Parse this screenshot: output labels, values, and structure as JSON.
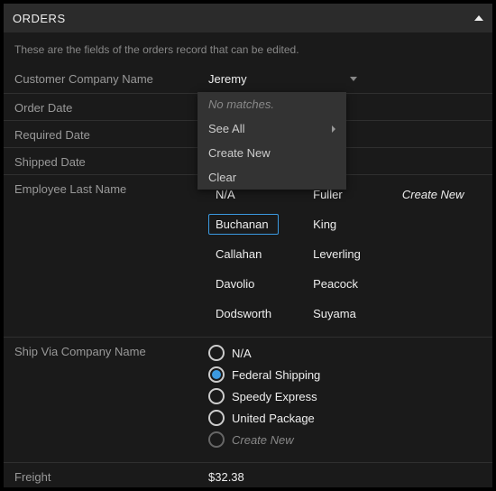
{
  "header": {
    "title": "ORDERS"
  },
  "helper": "These are the fields of the orders record that can be edited.",
  "fields": {
    "customerCompanyName": {
      "label": "Customer Company Name",
      "value": "Jeremy"
    },
    "orderDate": {
      "label": "Order Date"
    },
    "requiredDate": {
      "label": "Required Date"
    },
    "shippedDate": {
      "label": "Shipped Date"
    },
    "employeeLastName": {
      "label": "Employee Last Name"
    },
    "shipViaCompanyName": {
      "label": "Ship Via Company Name"
    },
    "freight": {
      "label": "Freight",
      "value": "$32.38"
    }
  },
  "dropdown": {
    "noMatches": "No matches.",
    "seeAll": "See All",
    "createNew": "Create New",
    "clear": "Clear"
  },
  "employees": {
    "col1": [
      "N/A",
      "Buchanan",
      "Callahan",
      "Davolio",
      "Dodsworth"
    ],
    "col2": [
      "Fuller",
      "King",
      "Leverling",
      "Peacock",
      "Suyama"
    ],
    "selected": "Buchanan",
    "createNew": "Create New"
  },
  "shipVia": {
    "options": [
      "N/A",
      "Federal Shipping",
      "Speedy Express",
      "United Package"
    ],
    "selected": "Federal Shipping",
    "createNew": "Create New"
  }
}
